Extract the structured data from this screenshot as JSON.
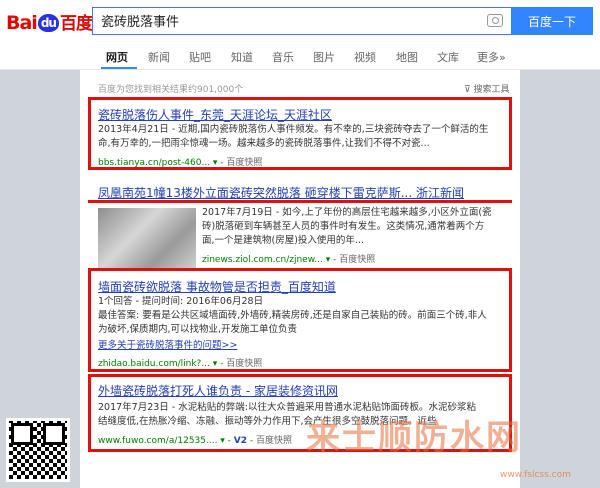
{
  "header": {
    "logo_left": "Bai",
    "logo_paw": "du",
    "logo_right": "百度",
    "search_value": "瓷砖脱落事件",
    "search_button": "百度一下"
  },
  "tabs": [
    "网页",
    "新闻",
    "贴吧",
    "知道",
    "音乐",
    "图片",
    "视频",
    "地图",
    "文库",
    "更多»"
  ],
  "result_count": "百度为您找到相关结果约901,000个",
  "search_tools": "搜索工具",
  "results": [
    {
      "title": "瓷砖脱落伤人事件_东莞_天涯论坛_天涯社区",
      "line1": "2013年4月21日 - 近期,国内瓷砖脱落伤人事件频发。有不幸的,三块瓷砖夺去了一个鲜活的生",
      "line2": "命,有万幸的,一把雨伞惊魂一场。越来越多的瓷砖脱落事件,让我们不得不对瓷...",
      "url": "bbs.tianya.cn/post-460...",
      "snapshot": "百度快照"
    },
    {
      "title": "凤凰南苑1幢13楼外立面瓷砖突然脱落 砸穿楼下雷克萨斯... 浙江新闻",
      "line1": "2017年7月19日 - 如今,上了年份的高层住宅越来越多,小区外立面(瓷",
      "line2": "砖)脱落砸到车辆甚至人员的事件时有发生。这类情况,通常着两个方",
      "line3": "面,一个是建筑物(房屋)投入使用的年...",
      "url": "zinews.ziol.com.cn/zjnew...",
      "snapshot": "百度快照"
    },
    {
      "title": "墙面瓷砖欲脱落 事故物管是否担责_百度知道",
      "line1": "1个回答 - 提问时间: 2016年06月28日",
      "line2": "最佳答案: 要看是公共区域墙面砖,外墙砖,精装房砖,还是自家自己装贴的砖。前面三个砖,非人",
      "line3": "为破坏,保质期内,可以找物业,开发施工单位负责",
      "more": "更多关于瓷砖脱落事件的问题>>",
      "url": "zhidao.baidu.com/link?...",
      "snapshot": "百度快照"
    },
    {
      "title": "外墙瓷砖脱落打死人谁负责 - 家居装修资讯网",
      "line1": "2017年7月23日 - 水泥粘贴的弊端:以往大众普遍采用普通水泥粘贴饰面砖板。水泥砂浆粘",
      "line2": "结缝度低,在热胀冷缩、冻融、振动等外力作用下,会产生很多空鼓脱落问题。近些",
      "url": "www.fuwo.com/a/12535....",
      "badge": "V2",
      "snapshot": "百度快照"
    }
  ],
  "watermark": "来士顺防水网",
  "watermark_url": "www.fslcss.com",
  "colors": {
    "highlight_box": "#e30f0f",
    "link": "#2440b3",
    "url": "#008000",
    "button": "#3385ff"
  }
}
